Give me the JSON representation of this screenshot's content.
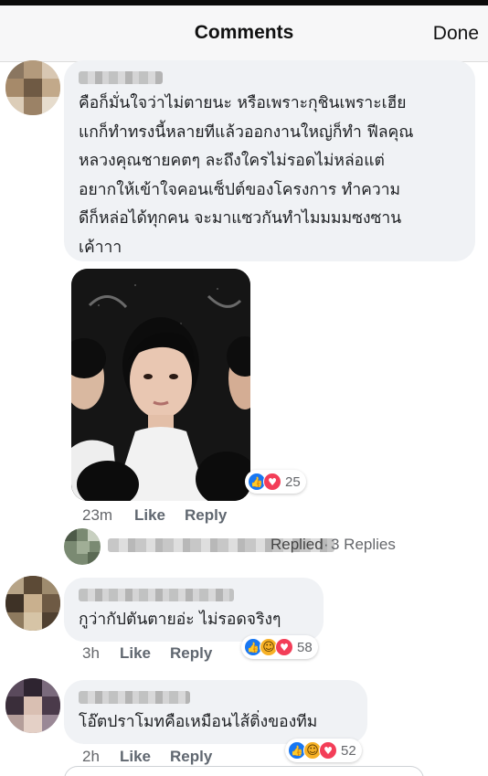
{
  "header": {
    "title": "Comments",
    "done_label": "Done"
  },
  "comments": [
    {
      "text": "คือก็มั่นใจว่าไม่ตายนะ หรือเพราะกุชินเพราะเฮีย\nแกก็ทำทรงนี้หลายทีแล้วออกงานใหญ่ก็ทำ ฟีลคุณ\nหลวงคุณชายคตๆ ละถึงใครไม่รอดไม่หล่อแต่\nอยากให้เข้าใจคอนเซ็ปต์ของโครงการ ทำความ\nดีก็หล่อได้ทุกคน จะมาแซวกันทำไมมมมซงซาน\nเค้าาา",
      "time": "23m",
      "like_label": "Like",
      "reply_label": "Reply",
      "reaction_count": "25",
      "reactions": [
        "like",
        "love"
      ],
      "replied_label": "Replied",
      "replies_label": "3 Replies"
    },
    {
      "text": "กูว่ากัปตันตายอ่ะ ไม่รอดจริงๆ",
      "time": "3h",
      "like_label": "Like",
      "reply_label": "Reply",
      "reaction_count": "58",
      "reactions": [
        "like",
        "haha",
        "love"
      ]
    },
    {
      "text": "โอ๊ตปราโมทคือเหมือนไส้ติ่งของทีม",
      "time": "2h",
      "like_label": "Like",
      "reply_label": "Reply",
      "reaction_count": "52",
      "reactions": [
        "like",
        "haha",
        "love"
      ]
    }
  ],
  "icons": {
    "like": "thumbs-up-icon",
    "love": "heart-icon",
    "haha": "laughing-face-icon"
  },
  "colors": {
    "like": "#1877f2",
    "love": "#f33e58",
    "haha": "#f7b125",
    "bubble": "#f0f2f5",
    "meta_text": "#65676b"
  }
}
